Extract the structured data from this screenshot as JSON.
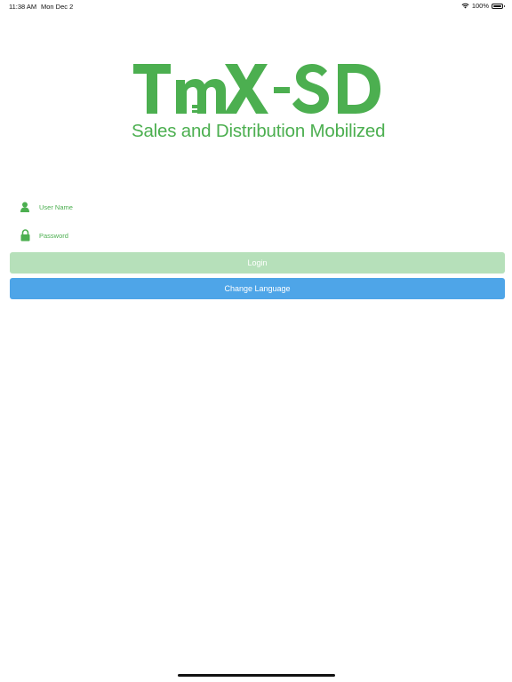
{
  "status_bar": {
    "time": "11:38 AM",
    "date": "Mon Dec 2",
    "battery": "100%",
    "wifi_icon": "wifi-icon",
    "battery_icon": "battery-icon"
  },
  "logo": {
    "wordmark": "TmX-SD",
    "tagline": "Sales and Distribution Mobilized",
    "color": "#4caf50"
  },
  "form": {
    "username_placeholder": "User Name",
    "username_icon": "user-icon",
    "password_placeholder": "Password",
    "password_icon": "lock-icon"
  },
  "buttons": {
    "login_label": "Login",
    "login_color": "#b6e0ba",
    "change_language_label": "Change Language",
    "change_language_color": "#4ea5e8"
  }
}
